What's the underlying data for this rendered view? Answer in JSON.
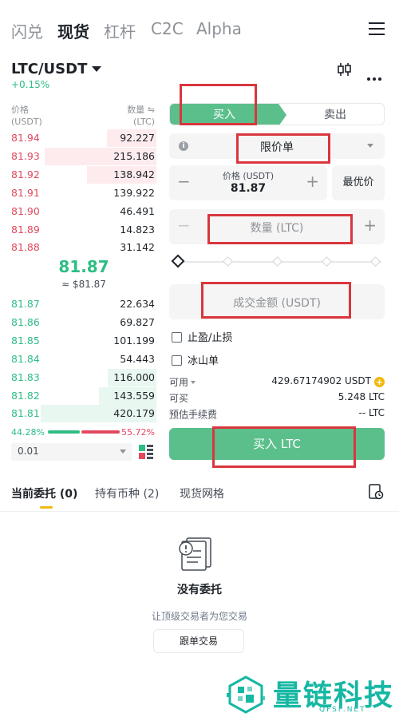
{
  "top_tabs": [
    "闪兑",
    "现货",
    "杠杆",
    "C2C",
    "Alpha"
  ],
  "top_tab_active": "现货",
  "pair": {
    "name": "LTC/USDT",
    "change": "+0.15%"
  },
  "orderbook": {
    "header_price": "价格",
    "header_price_unit": "(USDT)",
    "header_qty": "数量 ⇋",
    "header_qty_unit": "(LTC)",
    "asks": [
      {
        "price": "81.94",
        "qty": "92.227",
        "depth": 0.44
      },
      {
        "price": "81.93",
        "qty": "215.186",
        "depth": 1.0
      },
      {
        "price": "81.92",
        "qty": "138.942",
        "depth": 0.62
      },
      {
        "price": "81.91",
        "qty": "139.922",
        "depth": 0.0
      },
      {
        "price": "81.90",
        "qty": "46.491",
        "depth": 0.0
      },
      {
        "price": "81.89",
        "qty": "14.823",
        "depth": 0.0
      },
      {
        "price": "81.88",
        "qty": "31.142",
        "depth": 0.0
      }
    ],
    "last_price": "81.87",
    "last_price_usd": "≈ $81.87",
    "bids": [
      {
        "price": "81.87",
        "qty": "22.634",
        "depth": 0.0
      },
      {
        "price": "81.86",
        "qty": "69.827",
        "depth": 0.0
      },
      {
        "price": "81.85",
        "qty": "101.199",
        "depth": 0.0
      },
      {
        "price": "81.84",
        "qty": "54.443",
        "depth": 0.0
      },
      {
        "price": "81.83",
        "qty": "116.000",
        "depth": 0.42
      },
      {
        "price": "81.82",
        "qty": "143.559",
        "depth": 0.5
      },
      {
        "price": "81.81",
        "qty": "420.179",
        "depth": 1.0
      }
    ],
    "buy_ratio": "44.28%",
    "sell_ratio": "55.72%",
    "precision": "0.01"
  },
  "form": {
    "buy_tab": "买入",
    "sell_tab": "卖出",
    "order_type": "限价单",
    "price_label": "价格 (USDT)",
    "price_value": "81.87",
    "best_price": "最优价",
    "qty_placeholder": "数量 (LTC)",
    "total_placeholder": "成交金额 (USDT)",
    "tp_sl": "止盈/止损",
    "iceberg": "冰山单",
    "available_label": "可用",
    "available_value": "429.67174902 USDT",
    "can_buy_label": "可买",
    "can_buy_value": "5.248 LTC",
    "fee_label": "预估手续费",
    "fee_value": "-- LTC",
    "submit": "买入 LTC"
  },
  "bottom_tabs": [
    "当前委托 (0)",
    "持有币种 (2)",
    "现货网格"
  ],
  "empty": {
    "title": "没有委托",
    "subtitle": "让顶级交易者为您交易",
    "button": "跟单交易"
  },
  "watermark": {
    "text": "量链科技",
    "sub": "QFSP.NET"
  },
  "colors": {
    "buy": "#5bbf8c",
    "sell": "#e2485e",
    "accent": "#f0b90b",
    "highlight": "#d9363e"
  }
}
